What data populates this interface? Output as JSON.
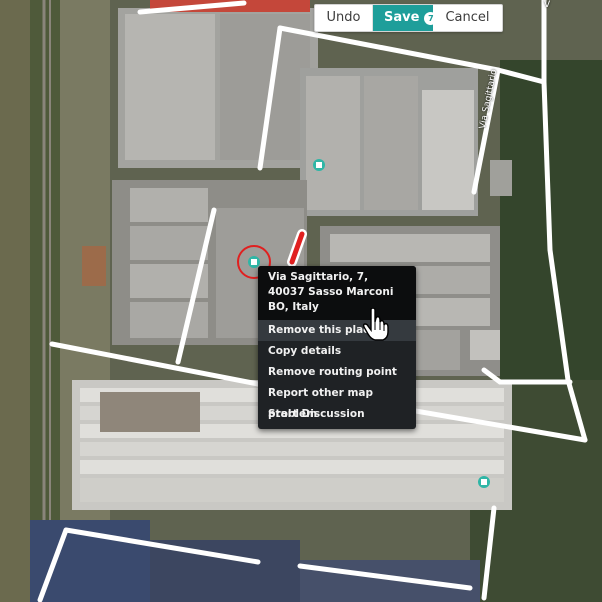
{
  "toolbar": {
    "undo_label": "Undo",
    "save_label": "Save",
    "save_count": "7",
    "cancel_label": "Cancel",
    "accent_color": "#1e9e9a"
  },
  "map": {
    "street_label": "Via Sagittario",
    "top_right_label": "V",
    "place_marker_icon": "building-icon",
    "selected_marker_color": "#e02020"
  },
  "context_menu": {
    "address": "Via Sagittario, 7, 40037 Sasso Marconi BO, Italy",
    "items": [
      {
        "label": "Remove this place"
      },
      {
        "label": "Copy details"
      },
      {
        "label": "Remove routing point"
      },
      {
        "label": "Report other map problem"
      },
      {
        "label": "Start Discussion"
      }
    ]
  }
}
